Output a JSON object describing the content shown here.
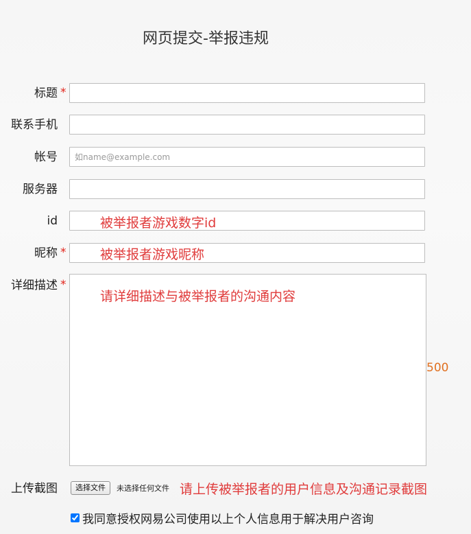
{
  "page": {
    "title": "网页提交-举报违规"
  },
  "form": {
    "required_mark": "*",
    "fields": {
      "title": {
        "label": "标题",
        "value": "",
        "required": true
      },
      "phone": {
        "label": "联系手机",
        "value": ""
      },
      "account": {
        "label": "帐号",
        "value": "",
        "placeholder": "如name@example.com"
      },
      "server": {
        "label": "服务器",
        "value": ""
      },
      "id": {
        "label": "id",
        "value": "",
        "hint": "被举报者游戏数字id"
      },
      "nickname": {
        "label": "昵称",
        "value": "",
        "required": true,
        "hint": "被举报者游戏昵称"
      },
      "details": {
        "label": "详细描述",
        "value": "",
        "required": true,
        "hint": "请详细描述与被举报者的沟通内容",
        "counter": "500"
      }
    },
    "upload": {
      "label": "上传截图",
      "button_label": "选择文件",
      "status": "未选择任何文件",
      "hint": "请上传被举报者的用户信息及沟通记录截图"
    },
    "consent": {
      "label": "我同意授权网易公司使用以上个人信息用于解决用户咨询",
      "checked": true
    }
  },
  "colors": {
    "required": "#e2231a",
    "hint": "#e03c3c",
    "counter": "#e07020",
    "border": "#bdbdbd",
    "checkbox_accent": "#0075ff"
  }
}
